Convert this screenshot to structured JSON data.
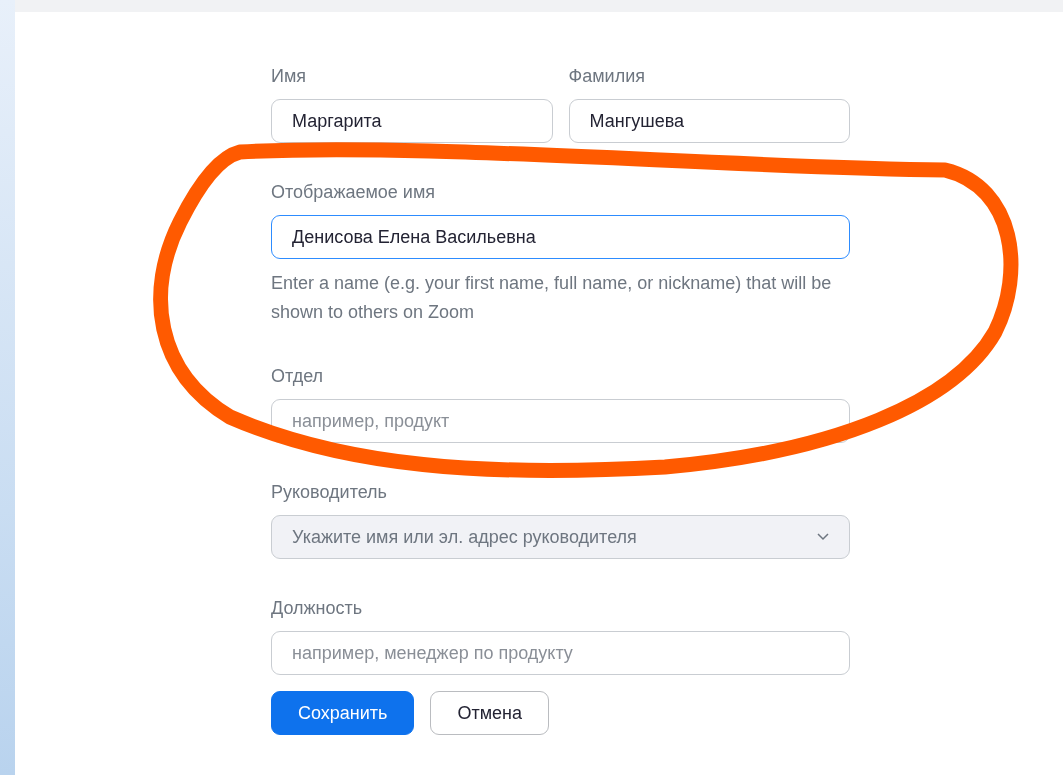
{
  "name_row": [
    {
      "label": "Имя",
      "value": "Маргарита",
      "focused": false
    },
    {
      "label": "Фамилия",
      "value": "Мангушева",
      "focused": false
    }
  ],
  "fields": [
    {
      "kind": "text",
      "label": "Отображаемое имя",
      "value": "Денисова Елена Васильевна",
      "focused": true,
      "help": "Enter a name (e.g. your first name, full name, or nickname) that will be shown to others on Zoom"
    },
    {
      "kind": "text",
      "label": "Отдел",
      "placeholder": "например, продукт",
      "focused": false
    },
    {
      "kind": "select",
      "label": "Руководитель",
      "placeholder": "Укажите имя или эл. адрес руководителя",
      "focused": false
    },
    {
      "kind": "text",
      "label": "Должность",
      "placeholder": "например, менеджер по продукту",
      "focused": false
    }
  ],
  "buttons": [
    {
      "label": "Сохранить",
      "kind": "primary"
    },
    {
      "label": "Отмена",
      "kind": "secondary"
    }
  ]
}
